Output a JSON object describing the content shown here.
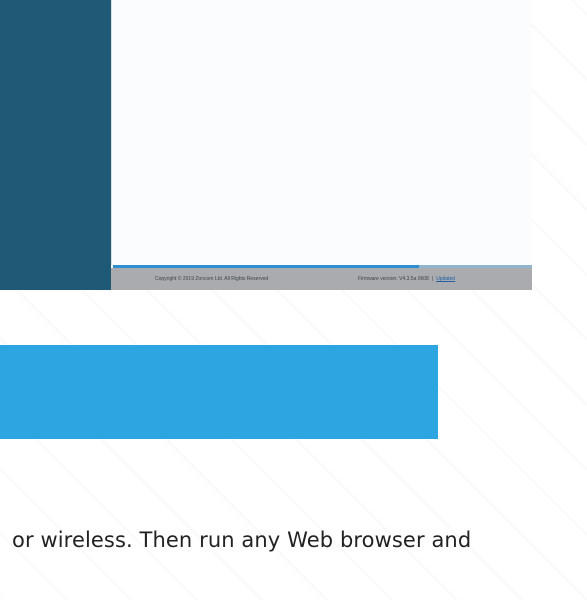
{
  "screenshot": {
    "footer": {
      "copyright": "Copyright © 2019 Zoncom Ltd. All Rights Reserved",
      "firmware": "Firmware version: V4.3.5a 0608",
      "separator": "|",
      "link": "Updated"
    },
    "progress": 0.73
  },
  "banner": {
    "color": "#2da5e0"
  },
  "body_text": "or wireless. Then run any Web browser and"
}
